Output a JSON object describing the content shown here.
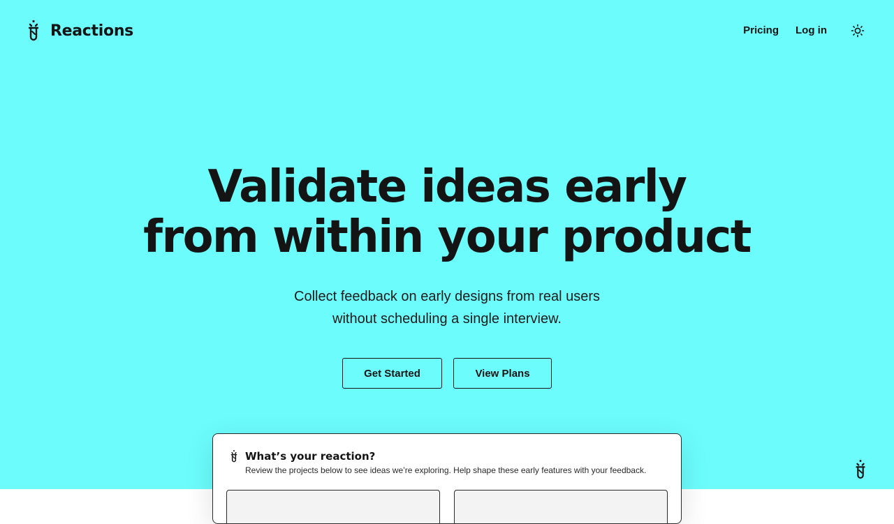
{
  "brand": {
    "name": "Reactions",
    "logo_icon": "flask-tube-icon"
  },
  "nav": {
    "pricing_label": "Pricing",
    "login_label": "Log in",
    "theme_icon": "sun-icon"
  },
  "hero": {
    "headline_line1": "Validate ideas early",
    "headline_line2": "from within your product",
    "subline_line1": "Collect feedback on early designs from real users",
    "subline_line2": "without scheduling a single interview.",
    "primary_cta": "Get Started",
    "secondary_cta": "View Plans"
  },
  "widget": {
    "title": "What’s your reaction?",
    "description": "Review the projects below to see ideas we’re exploring. Help shape these early features with your feedback.",
    "launcher_icon": "flask-tube-icon"
  },
  "colors": {
    "hero_background": "#6cfcfc",
    "text": "#141414",
    "card_background": "#ffffff"
  }
}
